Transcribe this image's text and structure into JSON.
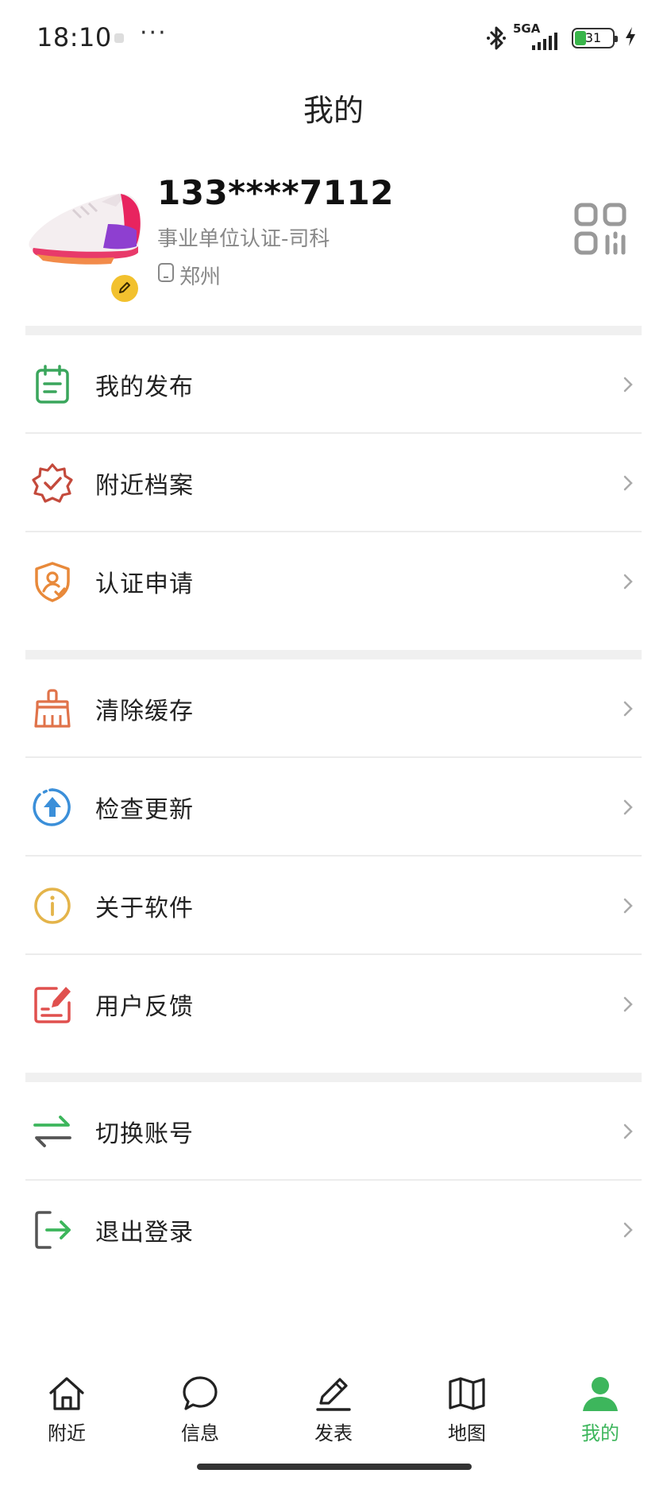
{
  "status_bar": {
    "time": "18:10",
    "more": "···",
    "network": "5GA",
    "battery": "31",
    "battery_level": 0.31
  },
  "header": {
    "title": "我的"
  },
  "profile": {
    "phone": "133****7112",
    "certification": "事业单位认证-司科",
    "city": "郑州"
  },
  "menu": {
    "groups": [
      [
        {
          "label": "我的发布",
          "icon": "calendar-list-icon",
          "color": "#3aa65c"
        },
        {
          "label": "附近档案",
          "icon": "badge-check-icon",
          "color": "#c44a3c"
        },
        {
          "label": "认证申请",
          "icon": "shield-user-icon",
          "color": "#e8893a"
        }
      ],
      [
        {
          "label": "清除缓存",
          "icon": "broom-icon",
          "color": "#e0734a"
        },
        {
          "label": "检查更新",
          "icon": "upload-circle-icon",
          "color": "#3b8fd9"
        },
        {
          "label": "关于软件",
          "icon": "info-circle-icon",
          "color": "#e4b44a"
        },
        {
          "label": "用户反馈",
          "icon": "feedback-edit-icon",
          "color": "#e0504e"
        }
      ],
      [
        {
          "label": "切换账号",
          "icon": "swap-arrows-icon",
          "color": "#3db65c"
        },
        {
          "label": "退出登录",
          "icon": "logout-icon",
          "color": "#3db65c"
        }
      ]
    ]
  },
  "tabs": [
    {
      "label": "附近",
      "icon": "home-icon"
    },
    {
      "label": "信息",
      "icon": "chat-bubble-icon"
    },
    {
      "label": "发表",
      "icon": "pencil-icon"
    },
    {
      "label": "地图",
      "icon": "map-icon"
    },
    {
      "label": "我的",
      "icon": "user-icon",
      "active": true
    }
  ],
  "colors": {
    "accent": "#3db65c",
    "divider": "#ececec",
    "section_gap": "#f0f0f0",
    "secondary_text": "#888888"
  }
}
